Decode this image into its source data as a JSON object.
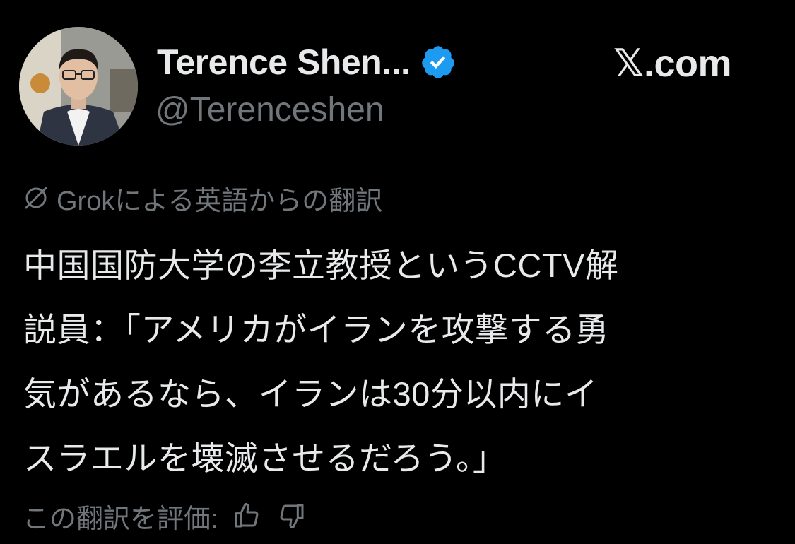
{
  "author": {
    "display_name": "Terence Shen...",
    "handle": "@Terenceshen",
    "verified": true,
    "avatar_icon": "user-avatar"
  },
  "site_label": "𝕏.com",
  "translation_note": "Grokによる英語からの翻訳",
  "tweet_lines": [
    "中国国防大学の李立教授というCCTV解",
    "説員：「アメリカがイランを攻撃する勇",
    "気があるなら、イランは30分以内にイ",
    "スラエルを壊滅させるだろう。」"
  ],
  "rate_translation": {
    "label": "この翻訳を評価:",
    "like_icon": "thumbs-up-icon",
    "dislike_icon": "thumbs-down-icon"
  },
  "colors": {
    "background": "#000000",
    "primary_text": "#e7e9ea",
    "secondary_text": "#71767b",
    "verified_badge": "#1d9bf0"
  }
}
